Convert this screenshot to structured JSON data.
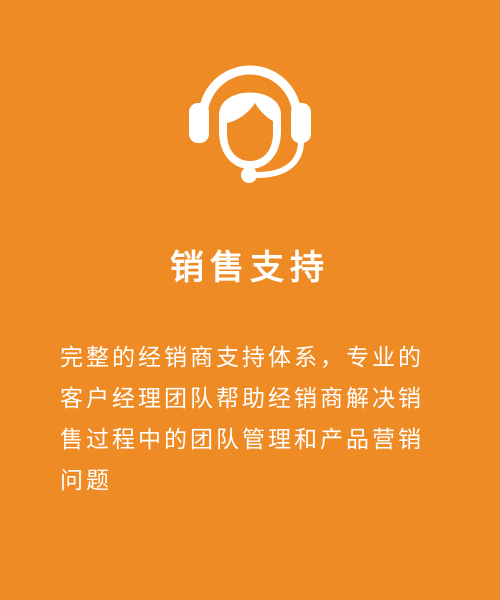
{
  "card": {
    "icon": "customer-service-headset-icon",
    "title": "销售支持",
    "description": "完整的经销商支持体系，专业的客户经理团队帮助经销商解决销售过程中的团队管理和产品营销问题"
  },
  "colors": {
    "background": "#EE8B25",
    "foreground": "#FFFFFF"
  }
}
